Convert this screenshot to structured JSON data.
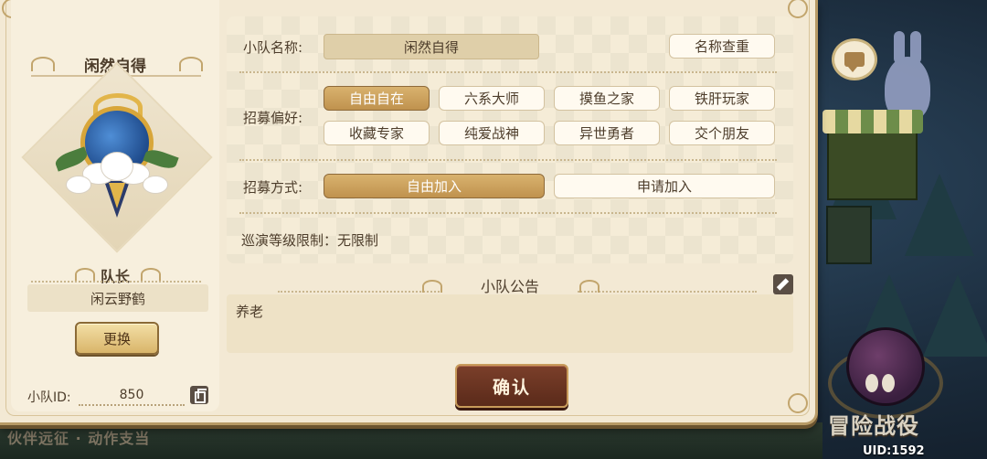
{
  "left": {
    "team_name": "闲然自得",
    "captain_label": "队长",
    "captain_name": "闲云野鹤",
    "swap_label": "更换",
    "team_id_label": "小队ID:",
    "team_id_value": "850"
  },
  "form": {
    "name_label": "小队名称:",
    "name_value": "闲然自得",
    "name_check_label": "名称查重",
    "pref_label": "招募偏好:",
    "preferences": [
      {
        "label": "自由自在",
        "selected": true
      },
      {
        "label": "六系大师",
        "selected": false
      },
      {
        "label": "摸鱼之家",
        "selected": false
      },
      {
        "label": "铁肝玩家",
        "selected": false
      },
      {
        "label": "收藏专家",
        "selected": false
      },
      {
        "label": "纯爱战神",
        "selected": false
      },
      {
        "label": "异世勇者",
        "selected": false
      },
      {
        "label": "交个朋友",
        "selected": false
      }
    ],
    "method_label": "招募方式:",
    "methods": [
      {
        "label": "自由加入",
        "selected": true
      },
      {
        "label": "申请加入",
        "selected": false
      }
    ],
    "level_limit": "巡演等级限制：无限制"
  },
  "notice": {
    "title": "小队公告",
    "content": "养老"
  },
  "confirm_label": "确认",
  "background": {
    "adventure_label": "冒险战役",
    "uid_label": "UID:1592",
    "bottom_text": "伙伴远征 · 动作支当"
  },
  "colors": {
    "selected": "#c79a58",
    "confirm": "#6a321f",
    "panel": "#f3e9d4"
  }
}
